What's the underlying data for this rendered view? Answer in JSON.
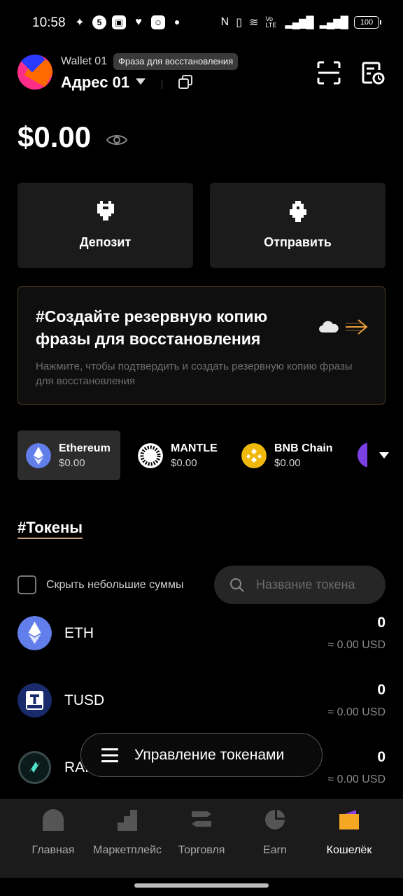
{
  "status_bar": {
    "time": "10:58",
    "battery": "100",
    "network_label": "Vo LTE"
  },
  "header": {
    "wallet_name": "Wallet 01",
    "tooltip": "Фраза для восстановления",
    "address_label": "Адрес 01"
  },
  "balance": {
    "amount": "$0.00"
  },
  "actions": {
    "deposit_label": "Депозит",
    "send_label": "Отправить"
  },
  "backup_banner": {
    "title": "#Создайте резервную копию фразы для восстановления",
    "subtitle": "Нажмите, чтобы подтвердить и создать резервную копию фразы для восстановления"
  },
  "chains": [
    {
      "name": "Ethereum",
      "balance": "$0.00",
      "icon": "ethereum-icon",
      "color": "#627eea",
      "active": true
    },
    {
      "name": "MANTLE",
      "balance": "$0.00",
      "icon": "mantle-icon",
      "color": "#ffffff",
      "active": false
    },
    {
      "name": "BNB Chain",
      "balance": "$0.00",
      "icon": "bnb-icon",
      "color": "#f0b90b",
      "active": false
    }
  ],
  "tokens_section": {
    "title": "#Токены",
    "hide_small_label": "Скрыть небольшие суммы",
    "search_placeholder": "Название токена"
  },
  "tokens": [
    {
      "name": "ETH",
      "amount": "0",
      "usd": "≈ 0.00 USD",
      "icon": "eth-token-icon"
    },
    {
      "name": "TUSD",
      "amount": "0",
      "usd": "≈ 0.00 USD",
      "icon": "tusd-token-icon"
    },
    {
      "name": "RAI",
      "amount": "0",
      "usd": "≈ 0.00 USD",
      "icon": "rai-token-icon"
    }
  ],
  "manage_tokens": {
    "label": "Управление токенами"
  },
  "bottom_nav": {
    "items": [
      {
        "label": "Главная",
        "icon": "home-icon"
      },
      {
        "label": "Маркетплейс",
        "icon": "marketplace-icon"
      },
      {
        "label": "Торговля",
        "icon": "trade-icon"
      },
      {
        "label": "Earn",
        "icon": "earn-icon"
      },
      {
        "label": "Кошелёк",
        "icon": "wallet-icon",
        "active": true
      }
    ]
  },
  "colors": {
    "background": "#000000",
    "card": "#1b1b1b",
    "accent": "#e9a03b",
    "muted_text": "#6e6e6e"
  }
}
